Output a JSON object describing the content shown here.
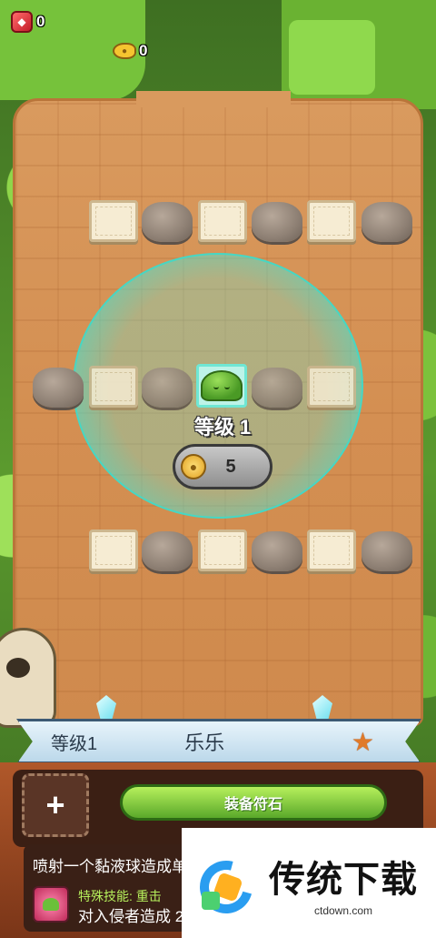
{
  "hud": {
    "gems": "0",
    "fish": "0"
  },
  "board": {
    "level_label": "等级 1",
    "upgrade_cost": "5"
  },
  "ribbon": {
    "level": "等级1",
    "name": "乐乐",
    "star_icon": "star-icon"
  },
  "panel": {
    "add_label": "+",
    "equip_button": "装备符石",
    "description": "喷射一个黏液球造成单",
    "skill_title": "特殊技能: 重击",
    "skill_description": "对入侵者造成 2"
  },
  "watermark": {
    "title": "传统下载",
    "url": "ctdown.com"
  },
  "colors": {
    "range_ring": "#46d7c4",
    "equip_green": "#5aa82a",
    "panel_brown": "#7a3518"
  }
}
